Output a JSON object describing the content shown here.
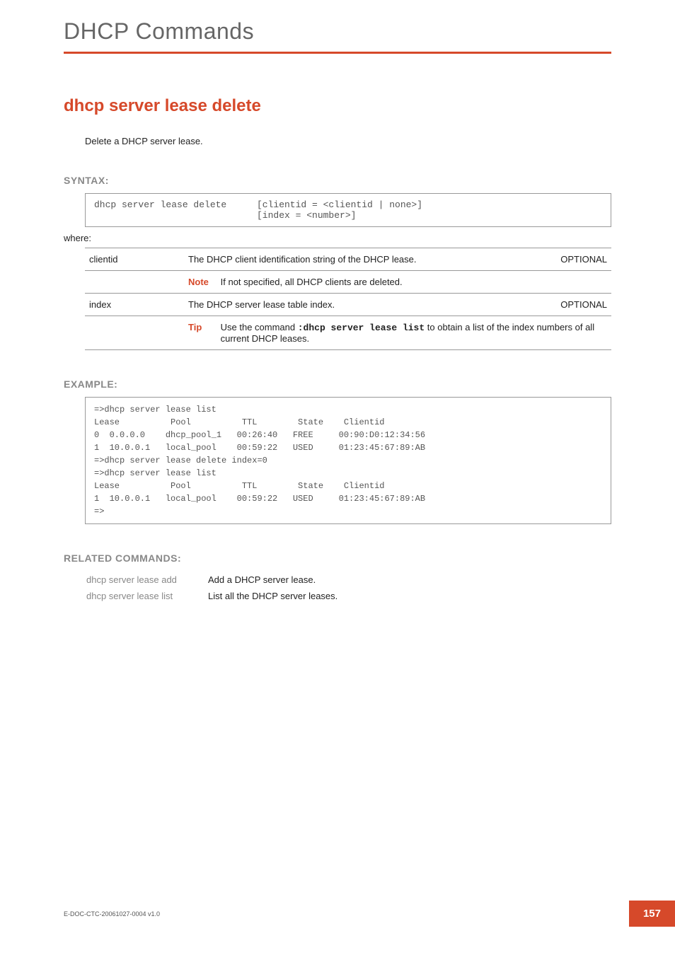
{
  "chapter": "DHCP Commands",
  "command": {
    "title": "dhcp server lease delete",
    "description": "Delete a DHCP server lease."
  },
  "syntax": {
    "label": "SYNTAX:",
    "cmd": "dhcp server lease delete",
    "args": "[clientid = <clientid | none>]\n[index = <number>]",
    "where": "where:",
    "params": [
      {
        "name": "clientid",
        "desc": "The DHCP client identification string of the DHCP lease.",
        "req": "OPTIONAL",
        "note_label": "Note",
        "note_text": "If not specified, all DHCP clients are deleted."
      },
      {
        "name": "index",
        "desc": "The DHCP server lease table index.",
        "req": "OPTIONAL",
        "tip_label": "Tip",
        "tip_pre": "Use the command ",
        "tip_code": ":dhcp server lease list",
        "tip_post": " to obtain a list of the index numbers of all current DHCP leases."
      }
    ]
  },
  "example": {
    "label": "EXAMPLE:",
    "text": "=>dhcp server lease list\nLease          Pool          TTL        State    Clientid\n0  0.0.0.0    dhcp_pool_1   00:26:40   FREE     00:90:D0:12:34:56\n1  10.0.0.1   local_pool    00:59:22   USED     01:23:45:67:89:AB\n=>dhcp server lease delete index=0\n=>dhcp server lease list\nLease          Pool          TTL        State    Clientid\n1  10.0.0.1   local_pool    00:59:22   USED     01:23:45:67:89:AB\n=>"
  },
  "related": {
    "label": "RELATED COMMANDS:",
    "rows": [
      {
        "cmd": "dhcp server lease add",
        "desc": "Add a DHCP server lease."
      },
      {
        "cmd": "dhcp server lease list",
        "desc": "List all the DHCP server leases."
      }
    ]
  },
  "footer": {
    "doc_id": "E-DOC-CTC-20061027-0004 v1.0",
    "page": "157"
  }
}
